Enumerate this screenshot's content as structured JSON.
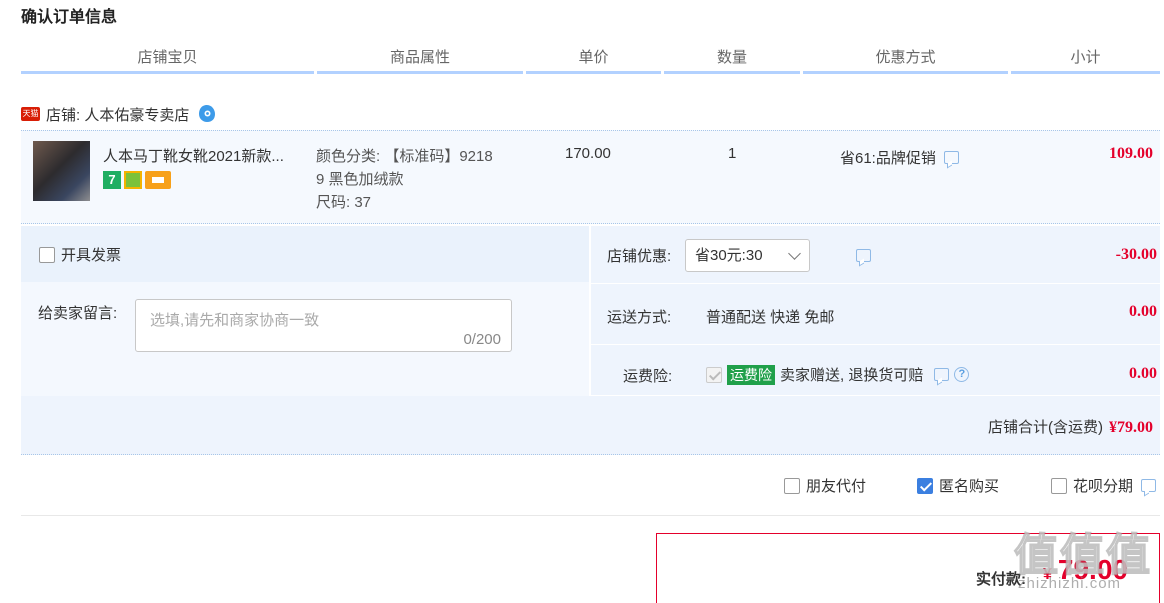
{
  "page_title": "确认订单信息",
  "columns": [
    "店铺宝贝",
    "商品属性",
    "单价",
    "数量",
    "优惠方式",
    "小计"
  ],
  "shop": {
    "badge": "天猫",
    "label": "店铺: 人本佑豪专卖店"
  },
  "item": {
    "name": "人本马丁靴女靴2021新款...",
    "badge_icons": [
      "seven-day-return-icon",
      "flower-badge-icon",
      "card-badge-icon"
    ],
    "badge_text_7": "7",
    "attr_line1": "颜色分类: 【标准码】9218",
    "attr_line2": "9 黑色加绒款",
    "attr_line3": "尺码: 37",
    "price": "170.00",
    "quantity": "1",
    "promo": "省61:品牌促销",
    "subtotal": "109.00"
  },
  "invoice_label": "开具发票",
  "remark": {
    "label": "给卖家留言:",
    "placeholder": "选填,请先和商家协商一致",
    "counter": "0/200"
  },
  "shop_discount": {
    "label": "店铺优惠:",
    "selected": "省30元:30",
    "value": "-30.00"
  },
  "shipping": {
    "label": "运送方式:",
    "method": "普通配送 快递 免邮",
    "value": "0.00"
  },
  "insurance": {
    "label": "运费险:",
    "tag": "运费险",
    "text": "卖家赠送, 退换货可赔",
    "value": "0.00"
  },
  "shop_total": {
    "label": "店铺合计(含运费)",
    "amount": "¥79.00"
  },
  "options": {
    "friend_pay": "朋友代付",
    "anonymous": "匿名购买",
    "huabei": "花呗分期",
    "anonymous_checked": true
  },
  "payment": {
    "label": "实付款:",
    "currency": "¥",
    "amount": "79.00"
  },
  "watermark": {
    "main": "值值值",
    "sub": "zhizhizhi.com"
  },
  "colors": {
    "accent_red": "#e4002b",
    "header_underline": "#b2d1ff",
    "row_bg": "#eef4fd",
    "checkbox_blue": "#3b7fe0",
    "insurance_green": "#20a04a"
  }
}
